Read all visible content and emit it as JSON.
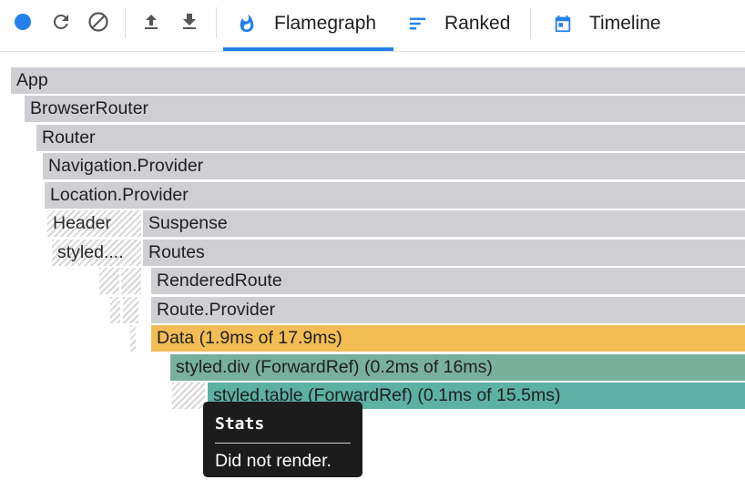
{
  "toolbar": {
    "record": {
      "icon": "record-icon",
      "color": "#2680eb"
    },
    "reload": {
      "icon": "reload-icon"
    },
    "clear": {
      "icon": "clear-icon"
    },
    "load": {
      "icon": "upload-icon"
    },
    "save": {
      "icon": "download-icon"
    }
  },
  "tabs": [
    {
      "label": "Flamegraph",
      "icon": "flame-icon",
      "selected": true
    },
    {
      "label": "Ranked",
      "icon": "ranked-icon",
      "selected": false
    },
    {
      "label": "Timeline",
      "icon": "calendar-icon",
      "selected": false
    }
  ],
  "colors": {
    "accent": "#2680eb",
    "gray": "#cfcfd3",
    "amber": "#f3bd55",
    "green": "#78b09c",
    "teal": "#5cb0a4"
  },
  "flamegraph": {
    "nodes": [
      {
        "label": "App"
      },
      {
        "label": "BrowserRouter"
      },
      {
        "label": "Router"
      },
      {
        "label": "Navigation.Provider"
      },
      {
        "label": "Location.Provider"
      },
      {
        "label": "Header"
      },
      {
        "label": "Suspense"
      },
      {
        "label": "styled...."
      },
      {
        "label": "Routes"
      },
      {
        "label": "RenderedRoute"
      },
      {
        "label": "Route.Provider"
      },
      {
        "label": "Data (1.9ms of 17.9ms)"
      },
      {
        "label": "styled.div (ForwardRef) (0.2ms of 16ms)"
      },
      {
        "label": "styled.table (ForwardRef) (0.1ms of 15.5ms)"
      }
    ]
  },
  "tooltip": {
    "title": "Stats",
    "body": "Did not render."
  }
}
